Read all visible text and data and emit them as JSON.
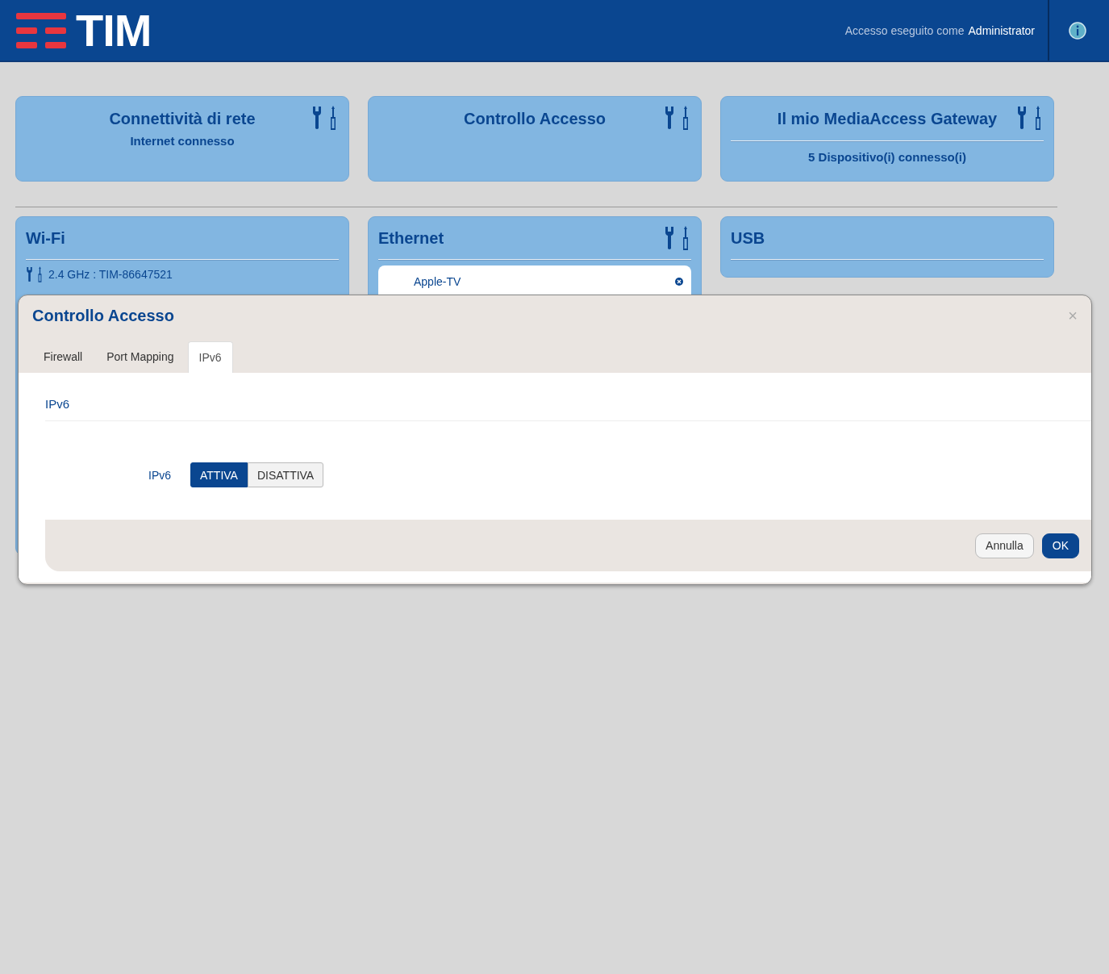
{
  "header": {
    "logo_text": "TIM",
    "login_prefix": "Accesso eseguito come",
    "login_user": "Administrator"
  },
  "top_cards": [
    {
      "title": "Connettività di rete",
      "subtitle": "Internet connesso",
      "divider": false,
      "tools": true
    },
    {
      "title": "Controllo Accesso",
      "tools": true,
      "divider": false
    },
    {
      "title": "Il mio MediaAccess Gateway",
      "subtitle": "5 Dispositivo(i) connesso(i)",
      "divider": true,
      "tools": true
    }
  ],
  "bottom_cards": [
    {
      "kind": "wifi",
      "title": "Wi-Fi",
      "tools": false,
      "lines": [
        "2.4 GHz : TIM-86647521"
      ]
    },
    {
      "kind": "ethernet",
      "title": "Ethernet",
      "tools": true,
      "devices": [
        "Apple-TV"
      ]
    },
    {
      "kind": "usb",
      "title": "USB",
      "tools": false
    }
  ],
  "modal": {
    "title": "Controllo Accesso",
    "close": "×",
    "tabs": [
      {
        "label": "Firewall",
        "selected": false
      },
      {
        "label": "Port Mapping",
        "selected": false
      },
      {
        "label": "IPv6",
        "selected": true
      }
    ],
    "section": "IPv6",
    "field": {
      "label": "IPv6",
      "options": [
        {
          "label": "ATTIVA",
          "selected": true
        },
        {
          "label": "DISATTIVA",
          "selected": false
        }
      ]
    },
    "buttons": [
      {
        "label": "Annulla",
        "kind": "secondary"
      },
      {
        "label": "OK",
        "kind": "primary"
      }
    ]
  }
}
